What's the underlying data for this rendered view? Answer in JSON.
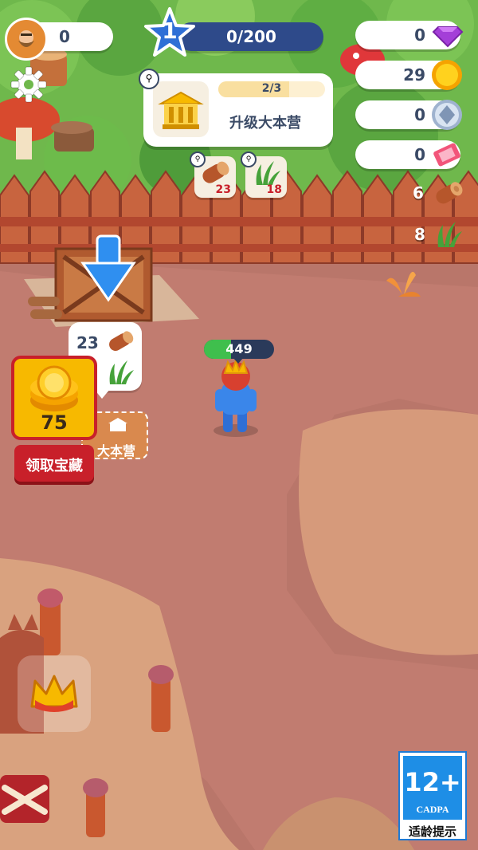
{
  "hud": {
    "followers": {
      "value": "0",
      "icon": "bearded-hero-avatar-icon"
    },
    "level": {
      "number": "1",
      "progress_text": "0/200",
      "progress_fraction": 0,
      "icon": "blue-star-icon"
    },
    "currencies": [
      {
        "name": "gems",
        "value": "0",
        "icon": "purple-gem-icon"
      },
      {
        "name": "coins",
        "value": "29",
        "icon": "gold-coin-icon"
      },
      {
        "name": "silver",
        "value": "0",
        "icon": "silver-token-icon"
      },
      {
        "name": "tickets",
        "value": "0",
        "icon": "pink-ticket-icon"
      }
    ],
    "resources": [
      {
        "name": "wood",
        "value": "6",
        "icon": "log-icon"
      },
      {
        "name": "grass",
        "value": "8",
        "icon": "grass-icon"
      }
    ]
  },
  "quest": {
    "progress_text": "2/3",
    "progress_fraction": 0.6667,
    "title": "升级大本营",
    "icon": "town-hall-icon",
    "requirements": [
      {
        "resource": "wood",
        "amount": "23",
        "icon": "log-icon"
      },
      {
        "resource": "grass",
        "amount": "18",
        "icon": "grass-icon"
      }
    ]
  },
  "deposit": {
    "wood": "23",
    "grass_icon": "grass-icon",
    "log_icon": "log-icon"
  },
  "hall_label": "大本营",
  "treasure": {
    "amount": "75",
    "button_label": "领取宝藏",
    "icon": "gold-coin-stack-icon"
  },
  "player": {
    "hp": "449"
  },
  "age_rating": {
    "age": "12+",
    "org": "CADPA",
    "note": "适龄提示"
  },
  "colors": {
    "star_blue": "#2f6fd6",
    "coin_gold": "#f7b900",
    "hp_green": "#3fbf4d",
    "quest_tan": "#f6efe1"
  }
}
